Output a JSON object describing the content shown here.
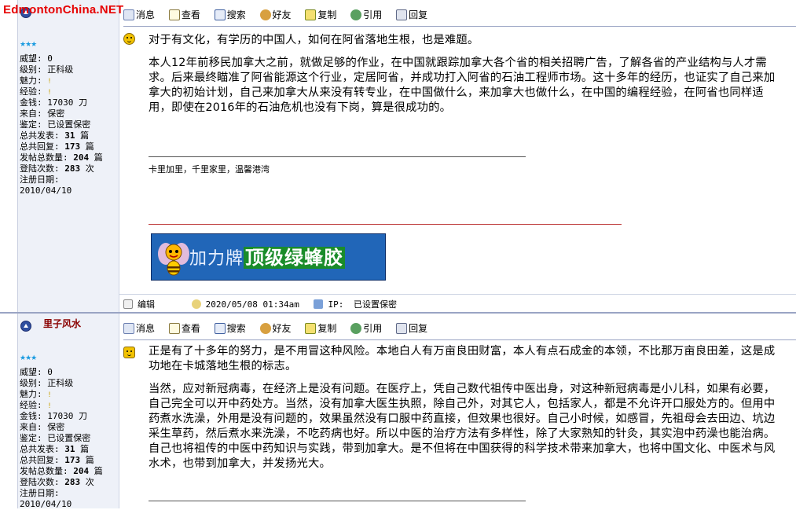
{
  "watermark": "EdmontonChina.NET",
  "toolbar": {
    "message": "消息",
    "view": "查看",
    "search": "搜索",
    "friend": "好友",
    "copy": "复制",
    "quote": "引用",
    "reply": "回复"
  },
  "profile": {
    "stars": "★★★",
    "prestige_label": "威望:",
    "prestige_value": "0",
    "level_label": "级别:",
    "level_value": "正科级",
    "charm_label": "魅力:",
    "charm_value": "!",
    "exp_label": "经验:",
    "exp_value": "!",
    "money_label": "金钱:",
    "money_value": "17030 刀",
    "from_label": "来自:",
    "from_value": "保密",
    "identify_label": "鉴定:",
    "identify_value": "已设置保密",
    "topics_label": "总共发表:",
    "topics_value": "31",
    "topics_unit": "篇",
    "replies_label": "总共回复:",
    "replies_value": "173",
    "replies_unit": "篇",
    "posts_label": "发帖总数量:",
    "posts_value": "204",
    "posts_unit": "篇",
    "logins_label": "登陆次数:",
    "logins_value": "283",
    "logins_unit": "次",
    "reg_label": "注册日期:",
    "reg_value": "2010/04/10"
  },
  "post1": {
    "first_line": "对于有文化，有学历的中国人，如何在阿省落地生根，也是难题。",
    "paragraph": "本人12年前移民加拿大之前，就做足够的作业，在中国就跟踪加拿大各个省的相关招聘广告，了解各省的产业结构与人才需求。后来最终瞄准了阿省能源这个行业，定居阿省，并成功打入阿省的石油工程师市场。这十多年的经历，也证实了自己来加拿大的初始计划，自己来加拿大从来没有转专业，在中国做什么，来加拿大也做什么，在中国的编程经验，在阿省也同样适用，即使在2016年的石油危机也没有下岗，算是很成功的。",
    "signature": "卡里加里，千里家里，温馨港湾",
    "banner_brand": "加力牌",
    "banner_product": "顶级绿蜂胶",
    "edit_label": "编辑",
    "datetime": "2020/05/08 01:34am",
    "ip_label": "IP:",
    "ip_value": "已设置保密"
  },
  "post2": {
    "username": "里子风水",
    "first_line": "正是有了十多年的努力，是不用冒这种风险。本地白人有万亩良田财富，本人有点石成金的本领，不比那万亩良田差，这是成功地在卡城落地生根的标志。",
    "paragraph": "当然，应对新冠病毒，在经济上是没有问题。在医疗上，凭自己数代祖传中医出身，对这种新冠病毒是小儿科，如果有必要，自己完全可以开中药处方。当然，没有加拿大医生执照，除自己外，对其它人，包括家人，都是不允许开口服处方的。但用中药煮水洗澡，外用是没有问题的，效果虽然没有口服中药直接，但效果也很好。自己小时候，如感冒，先祖母会去田边、坑边采生草药，然后煮水来洗澡，不吃药病也好。所以中医的治疗方法有多样性，除了大家熟知的针灸，其实泡中药澡也能治病。自己也将祖传的中医中药知识与实践，带到加拿大。是不但将在中国获得的科学技术带来加拿大，也将中国文化、中医术与风水术，也带到加拿大，并发扬光大。"
  },
  "colors": {
    "sidebar_bg": "#eef1f8",
    "watermark": "#e60000",
    "username": "#8a0000",
    "banner_bg": "#2166b8"
  }
}
